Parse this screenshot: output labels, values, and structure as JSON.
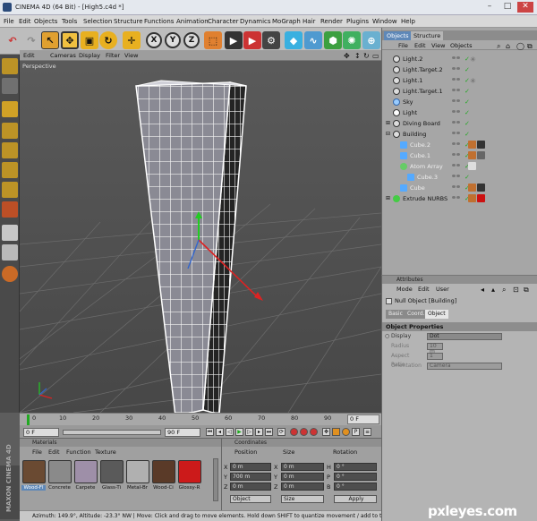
{
  "window": {
    "title": "CINEMA 4D (64 Bit) - [High5.c4d *]"
  },
  "menu": [
    "File",
    "Edit",
    "Objects",
    "Tools",
    "Selection",
    "Structure",
    "Functions",
    "Animation",
    "Character",
    "Dynamics",
    "MoGraph",
    "Hair",
    "Render",
    "Plugins",
    "Window",
    "Help"
  ],
  "toolbar": {
    "axis_labels": [
      "X",
      "Y",
      "Z"
    ]
  },
  "viewport": {
    "menu": [
      "Edit",
      "Cameras",
      "Display",
      "Filter",
      "View"
    ],
    "label": "Perspective"
  },
  "timeline": {
    "ticks": [
      "0",
      "10",
      "20",
      "30",
      "40",
      "50",
      "60",
      "70",
      "80",
      "90"
    ],
    "current_frame": "0 F"
  },
  "playback": {
    "start": "0 F",
    "end": "90 F"
  },
  "materials": {
    "title": "Materials",
    "menu": [
      "File",
      "Edit",
      "Function",
      "Texture"
    ],
    "items": [
      {
        "label": "Wood-Fl",
        "color": "#6a4a32"
      },
      {
        "label": "Concrete",
        "color": "#8a8a8a"
      },
      {
        "label": "Carpete",
        "color": "#9e8fa8"
      },
      {
        "label": "Glass-Ti",
        "color": "#5a5a5a"
      },
      {
        "label": "Metal-Br",
        "color": "#b0b0b0"
      },
      {
        "label": "Wood-Ci",
        "color": "#5a3a28"
      },
      {
        "label": "Glossy-R",
        "color": "#cc1a1a"
      }
    ]
  },
  "coordinates": {
    "title": "Coordinates",
    "headers": [
      "Position",
      "Size",
      "Rotation"
    ],
    "rows": [
      {
        "axis": "X",
        "pos": "0 m",
        "size": "0 m",
        "rot_label": "H",
        "rot": "0 °"
      },
      {
        "axis": "Y",
        "pos": "700 m",
        "size": "0 m",
        "rot_label": "P",
        "rot": "0 °"
      },
      {
        "axis": "Z",
        "pos": "0 m",
        "size": "0 m",
        "rot_label": "B",
        "rot": "0 °"
      }
    ],
    "mode_object": "Object",
    "mode_size": "Size",
    "apply": "Apply"
  },
  "status": "Azimuth: 149.9°, Altitude: -23.3°  NW  |  Move: Click and drag to move elements. Hold down SHIFT to quantize movement / add to the sele",
  "maxon_brand": "MAXON CINEMA 4D",
  "objects_panel": {
    "tabs": [
      "Objects",
      "Structure"
    ],
    "menu": [
      "File",
      "Edit",
      "View",
      "Objects"
    ],
    "items": [
      {
        "label": "Light.2",
        "indent": 0,
        "icon_color": "#ddd",
        "dim": false
      },
      {
        "label": "Light.Target.2",
        "indent": 0,
        "icon_color": "#ddd",
        "dim": false
      },
      {
        "label": "Light.1",
        "indent": 0,
        "icon_color": "#ddd",
        "dim": false
      },
      {
        "label": "Light.Target.1",
        "indent": 0,
        "icon_color": "#ddd",
        "dim": false
      },
      {
        "label": "Sky",
        "indent": 0,
        "icon_color": "#9cf",
        "dim": false
      },
      {
        "label": "Light",
        "indent": 0,
        "icon_color": "#fff",
        "dim": false
      },
      {
        "label": "Diving Board",
        "indent": 0,
        "icon_color": "#ddd",
        "dim": false
      },
      {
        "label": "Building",
        "indent": 0,
        "icon_color": "#ddd",
        "dim": false
      },
      {
        "label": "Cube.2",
        "indent": 1,
        "icon_color": "#5af",
        "dim": true
      },
      {
        "label": "Cube.1",
        "indent": 1,
        "icon_color": "#5af",
        "dim": true
      },
      {
        "label": "Atom Array",
        "indent": 1,
        "icon_color": "#6c6",
        "dim": true
      },
      {
        "label": "Cube.3",
        "indent": 2,
        "icon_color": "#5af",
        "dim": true
      },
      {
        "label": "Cube",
        "indent": 1,
        "icon_color": "#5af",
        "dim": true
      },
      {
        "label": "Extrude NURBS",
        "indent": 0,
        "icon_color": "#4c4",
        "dim": false
      }
    ]
  },
  "attributes": {
    "title": "Attributes",
    "menu": [
      "Mode",
      "Edit",
      "User"
    ],
    "object_name": "Null Object [Building]",
    "tabs": [
      "Basic",
      "Coord.",
      "Object"
    ],
    "section": "Object Properties",
    "props": [
      {
        "label": "Display",
        "value": "Dot",
        "dim": false
      },
      {
        "label": "Radius . . . .",
        "value": "10 m",
        "dim": true
      },
      {
        "label": "Aspect Ratio",
        "value": "1",
        "dim": true
      },
      {
        "label": "Orientation",
        "value": "Camera",
        "dim": true
      }
    ]
  },
  "watermark": "pxleyes.com"
}
